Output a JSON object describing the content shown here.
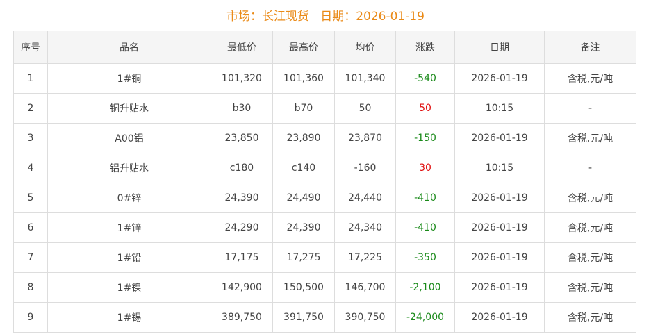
{
  "title": "市场：长江现货   日期：2026-01-19",
  "colors": {
    "title": "#ea8a17",
    "up": "#e01010",
    "down": "#1a8a1a"
  },
  "table": {
    "headers": [
      "序号",
      "品名",
      "最低价",
      "最高价",
      "均价",
      "涨跌",
      "日期",
      "备注"
    ],
    "rows": [
      {
        "no": "1",
        "name": "1#铜",
        "low": "101,320",
        "high": "101,360",
        "avg": "101,340",
        "change": "-540",
        "date": "2026-01-19",
        "note": "含税,元/吨"
      },
      {
        "no": "2",
        "name": "铜升贴水",
        "low": "b30",
        "high": "b70",
        "avg": "50",
        "change": "50",
        "date": "10:15",
        "note": "-"
      },
      {
        "no": "3",
        "name": "A00铝",
        "low": "23,850",
        "high": "23,890",
        "avg": "23,870",
        "change": "-150",
        "date": "2026-01-19",
        "note": "含税,元/吨"
      },
      {
        "no": "4",
        "name": "铝升贴水",
        "low": "c180",
        "high": "c140",
        "avg": "-160",
        "change": "30",
        "date": "10:15",
        "note": "-"
      },
      {
        "no": "5",
        "name": "0#锌",
        "low": "24,390",
        "high": "24,490",
        "avg": "24,440",
        "change": "-410",
        "date": "2026-01-19",
        "note": "含税,元/吨"
      },
      {
        "no": "6",
        "name": "1#锌",
        "low": "24,290",
        "high": "24,390",
        "avg": "24,340",
        "change": "-410",
        "date": "2026-01-19",
        "note": "含税,元/吨"
      },
      {
        "no": "7",
        "name": "1#铅",
        "low": "17,175",
        "high": "17,275",
        "avg": "17,225",
        "change": "-350",
        "date": "2026-01-19",
        "note": "含税,元/吨"
      },
      {
        "no": "8",
        "name": "1#镍",
        "low": "142,900",
        "high": "150,500",
        "avg": "146,700",
        "change": "-2,100",
        "date": "2026-01-19",
        "note": "含税,元/吨"
      },
      {
        "no": "9",
        "name": "1#锡",
        "low": "389,750",
        "high": "391,750",
        "avg": "390,750",
        "change": "-24,000",
        "date": "2026-01-19",
        "note": "含税,元/吨"
      }
    ]
  }
}
